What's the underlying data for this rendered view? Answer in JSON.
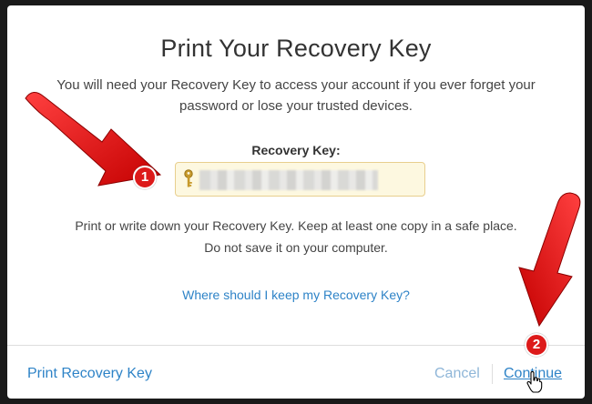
{
  "dialog": {
    "title": "Print Your Recovery Key",
    "description": "You will need your Recovery Key to access your account if you ever forget your password or lose your trusted devices.",
    "recovery_key_label": "Recovery Key:",
    "recovery_key_value": "",
    "note_line1": "Print or write down your Recovery Key. Keep at least one copy in a safe place.",
    "note_line2": "Do not save it on your computer.",
    "help_link": "Where should I keep my Recovery Key?"
  },
  "footer": {
    "print_label": "Print Recovery Key",
    "cancel_label": "Cancel",
    "continue_label": "Continue"
  },
  "annotations": {
    "badge1": "1",
    "badge2": "2"
  },
  "colors": {
    "link": "#2e83c7",
    "field_background": "#fdf8e0",
    "annotation_red": "#dd1a1a"
  }
}
